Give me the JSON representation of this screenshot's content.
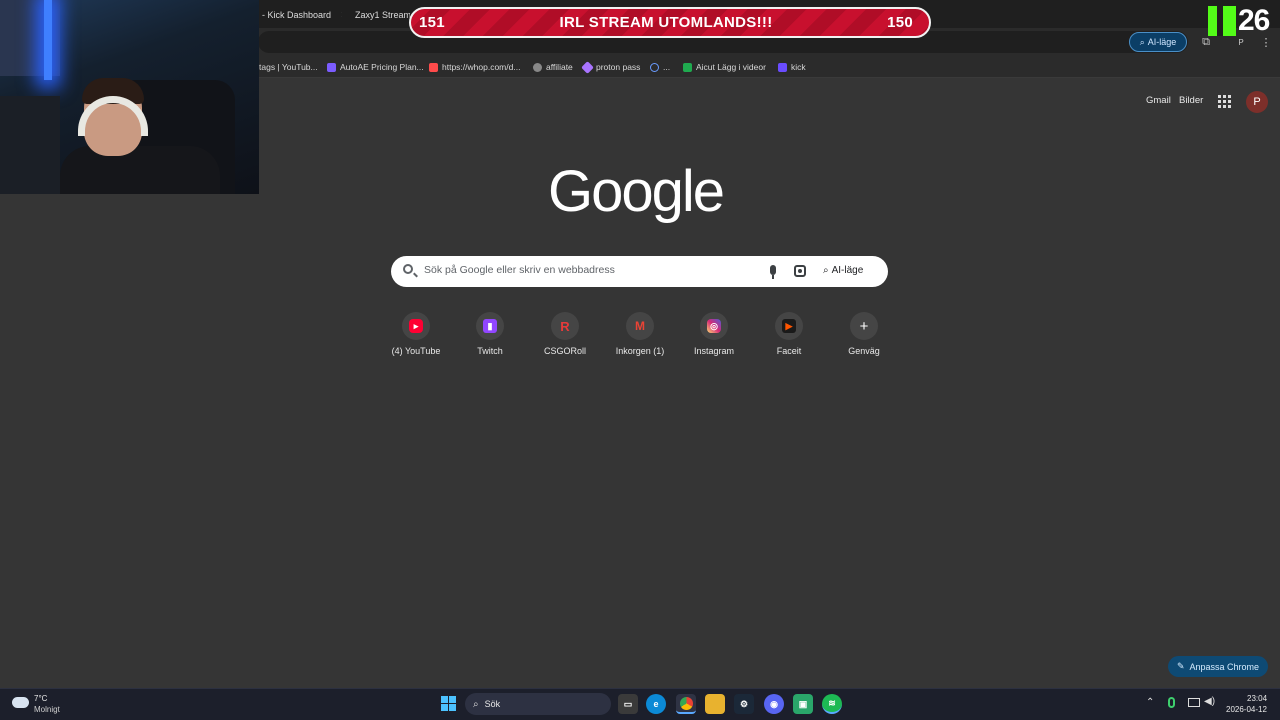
{
  "browser": {
    "tabs": [
      {
        "label": "- Kick Dashboard"
      },
      {
        "label": "Zaxy1 Stream"
      }
    ],
    "omnibox": {
      "ai_pill": "AI-läge"
    },
    "bookmarks": [
      {
        "label": "tags | YouTub...",
        "color": "#777777"
      },
      {
        "label": "AutoAE Pricing Plan...",
        "color": "#7b5cff"
      },
      {
        "label": "https://whop.com/d...",
        "color": "#ff4b4b"
      },
      {
        "label": "affiliate",
        "color": "#888888"
      },
      {
        "label": "proton pass",
        "color": "#a974ff"
      },
      {
        "label": "...",
        "color": "#6a9cff"
      },
      {
        "label": "Aicut Lägg i videor",
        "color": "#1faa4f"
      },
      {
        "label": "kick",
        "color": "#6a4cff"
      }
    ]
  },
  "stream_overlay": {
    "banner_left": "151",
    "banner_text": "IRL STREAM UTOMLANDS!!!",
    "banner_right": "150",
    "kick_count": "26",
    "kick_color": "#53fc18"
  },
  "google": {
    "header": {
      "gmail": "Gmail",
      "images": "Bilder",
      "avatar": "P"
    },
    "search": {
      "placeholder": "Sök på Google eller skriv en webbadress",
      "ai_mode": "AI-läge"
    },
    "shortcuts": [
      {
        "label": "(4) YouTube",
        "icon": "youtube-icon",
        "color": "#ff0033"
      },
      {
        "label": "Twitch",
        "icon": "twitch-icon",
        "color": "#9146ff"
      },
      {
        "label": "CSGORoll",
        "icon": "csgoroll-icon",
        "color": "#e63a3a"
      },
      {
        "label": "Inkorgen (1)",
        "icon": "gmail-icon",
        "color": "#ea4335"
      },
      {
        "label": "Instagram",
        "icon": "instagram-icon",
        "color": "#d62976"
      },
      {
        "label": "Faceit",
        "icon": "faceit-icon",
        "color": "#ff5500"
      },
      {
        "label": "Genväg",
        "icon": "plus-icon",
        "color": "#e8e8e8"
      }
    ],
    "customize": "Anpassa Chrome"
  },
  "taskbar": {
    "weather": {
      "temp": "7°C",
      "desc": "Molnigt"
    },
    "search_label": "Sök",
    "clock": {
      "time": "23:04",
      "date": "2026-04-12"
    }
  }
}
